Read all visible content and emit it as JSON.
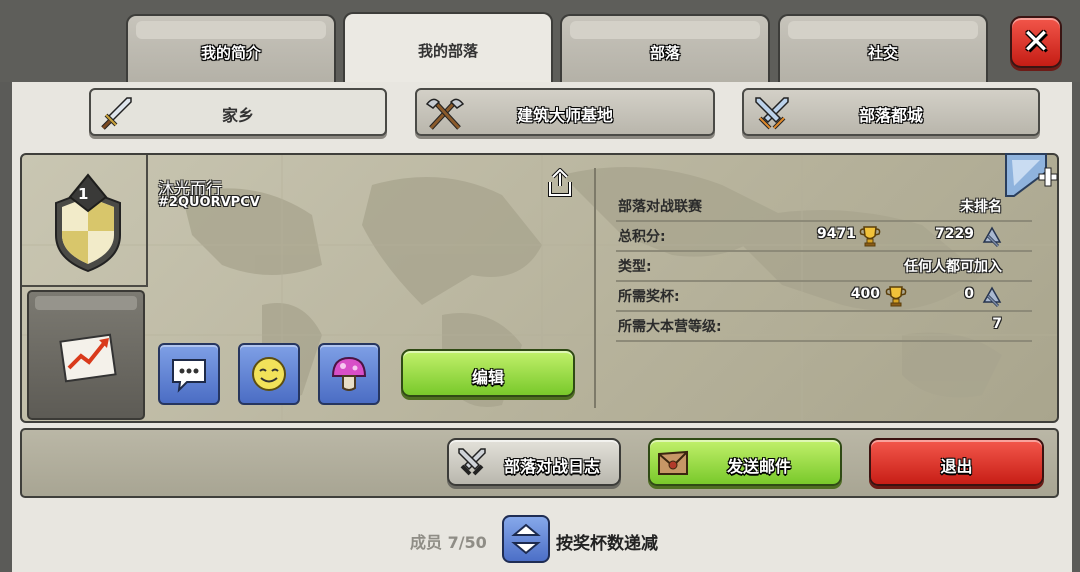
{
  "tabs": [
    {
      "label": "我的简介",
      "active": false
    },
    {
      "label": "我的部落",
      "active": true
    },
    {
      "label": "部落",
      "active": false
    },
    {
      "label": "社交",
      "active": false
    }
  ],
  "close_icon": "close-x-icon",
  "subtabs": [
    {
      "label": "家乡",
      "icon": "sword-icon",
      "active": true
    },
    {
      "label": "建筑大师基地",
      "icon": "crossed-axes-icon",
      "active": false
    },
    {
      "label": "部落都城",
      "icon": "crossed-swords-icon",
      "active": false
    }
  ],
  "clan": {
    "badge_level": "1",
    "name": "沐光而行",
    "tag": "#2QUORVPCV"
  },
  "buttons": {
    "edit": "编辑",
    "war_log": "部落对战日志",
    "send_mail": "发送邮件",
    "leave": "退出"
  },
  "info": {
    "war_league": {
      "key": "部落对战联赛",
      "value": "未排名"
    },
    "total_points": {
      "key": "总积分:",
      "trophies": "9471",
      "builder_trophies": "7229"
    },
    "type": {
      "key": "类型:",
      "value": "任何人都可加入"
    },
    "required_trophies": {
      "key": "所需奖杯:",
      "trophies": "400",
      "builder_trophies": "0"
    },
    "required_th": {
      "key": "所需大本营等级:",
      "value": "7"
    }
  },
  "footer": {
    "members": "成员 7/50",
    "sort_label": "按奖杯数递减"
  },
  "colors": {
    "green_button": "#8fd63a",
    "red_button": "#e1392e",
    "blue_button": "#5a7dd2",
    "panel": "#e8e6e0"
  }
}
